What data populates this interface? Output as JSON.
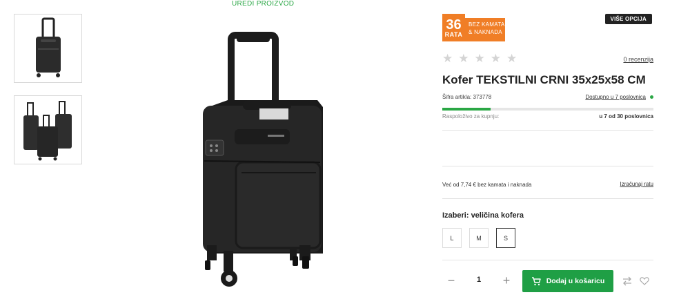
{
  "edit_link": "UREDI PROIZVOD",
  "thumbnails": [
    {
      "name": "single-suitcase"
    },
    {
      "name": "suitcase-set"
    }
  ],
  "badge": {
    "number": "36",
    "rata": "RATA",
    "line1": "BEZ KAMATA",
    "line2": "& NAKNADA",
    "color": "#f07e26"
  },
  "more_options": "VIŠE OPCIJA",
  "rating": {
    "stars": 0,
    "max": 5,
    "reviews": "0 recenzija"
  },
  "product": {
    "title": "Kofer TEKSTILNI CRNI 35x25x58 CM",
    "sku_label": "Šifra artikla:",
    "sku": "373778",
    "availability": "Dostupno u 7 poslovnica",
    "stock_fraction": 0.23,
    "stock_label": "Raspoloživo za kupnju:",
    "stock_value": "u 7 od 30 poslovnica"
  },
  "installment": {
    "text": "Već od 7,74 € bez kamata i naknada",
    "link": "Izračunaj ratu"
  },
  "size": {
    "heading": "Izaberi: veličina kofera",
    "options": [
      "L",
      "M",
      "S"
    ],
    "selected": "S"
  },
  "cart": {
    "quantity": "1",
    "add_label": "Dodaj u košaricu",
    "accent": "#1f9f45"
  }
}
